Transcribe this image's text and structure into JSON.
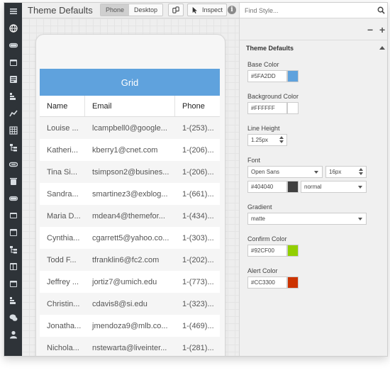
{
  "toolbar": {
    "title": "Theme Defaults",
    "phone_label": "Phone",
    "desktop_label": "Desktop",
    "inspect_label": "Inspect",
    "info_glyph": "i"
  },
  "rail": {
    "icons": [
      "globe-icon",
      "toggle-icon",
      "calendar-icon",
      "form-icon",
      "list-icon",
      "chart-icon",
      "grid-icon",
      "tree-icon",
      "link-icon",
      "trash-icon",
      "toggle-icon",
      "carousel-icon",
      "window-icon",
      "tree-icon",
      "panel-icon",
      "calendar-icon",
      "list-icon",
      "chat-icon",
      "user-icon"
    ]
  },
  "grid": {
    "title": "Grid",
    "columns": [
      "Name",
      "Email",
      "Phone"
    ],
    "rows": [
      [
        "Louise ...",
        "lcampbell0@google...",
        "1-(253)..."
      ],
      [
        "Katheri...",
        "kberry1@cnet.com",
        "1-(206)..."
      ],
      [
        "Tina Si...",
        "tsimpson2@busines...",
        "1-(206)..."
      ],
      [
        "Sandra...",
        "smartinez3@exblog...",
        "1-(661)..."
      ],
      [
        "Maria D...",
        "mdean4@themefor...",
        "1-(434)..."
      ],
      [
        "Cynthia...",
        "cgarrett5@yahoo.co...",
        "1-(303)..."
      ],
      [
        "Todd F...",
        "tfranklin6@fc2.com",
        "1-(202)..."
      ],
      [
        "Jeffrey ...",
        "jortiz7@umich.edu",
        "1-(773)..."
      ],
      [
        "Christin...",
        "cdavis8@si.edu",
        "1-(323)..."
      ],
      [
        "Jonatha...",
        "jmendoza9@mlb.co...",
        "1-(469)..."
      ],
      [
        "Nichola...",
        "nstewarta@liveinter...",
        "1-(281)..."
      ]
    ]
  },
  "panel": {
    "search_placeholder": "Find Style...",
    "minus": "−",
    "plus": "+",
    "section_title": "Theme Defaults",
    "base_color_label": "Base Color",
    "base_color_value": "#5FA2DD",
    "background_color_label": "Background Color",
    "background_color_value": "#FFFFFF",
    "line_height_label": "Line Height",
    "line_height_value": "1.25px",
    "font_label": "Font",
    "font_family_value": "Open Sans",
    "font_size_value": "16px",
    "font_color_value": "#404040",
    "font_weight_value": "normal",
    "gradient_label": "Gradient",
    "gradient_value": "matte",
    "confirm_color_label": "Confirm Color",
    "confirm_color_value": "#92CF00",
    "alert_color_label": "Alert Color",
    "alert_color_value": "#CC3300"
  },
  "colors": {
    "base": "#5fa2dd",
    "background": "#ffffff",
    "font": "#404040",
    "confirm": "#92cf00",
    "alert": "#cc3300",
    "rail": "#2e3338"
  }
}
